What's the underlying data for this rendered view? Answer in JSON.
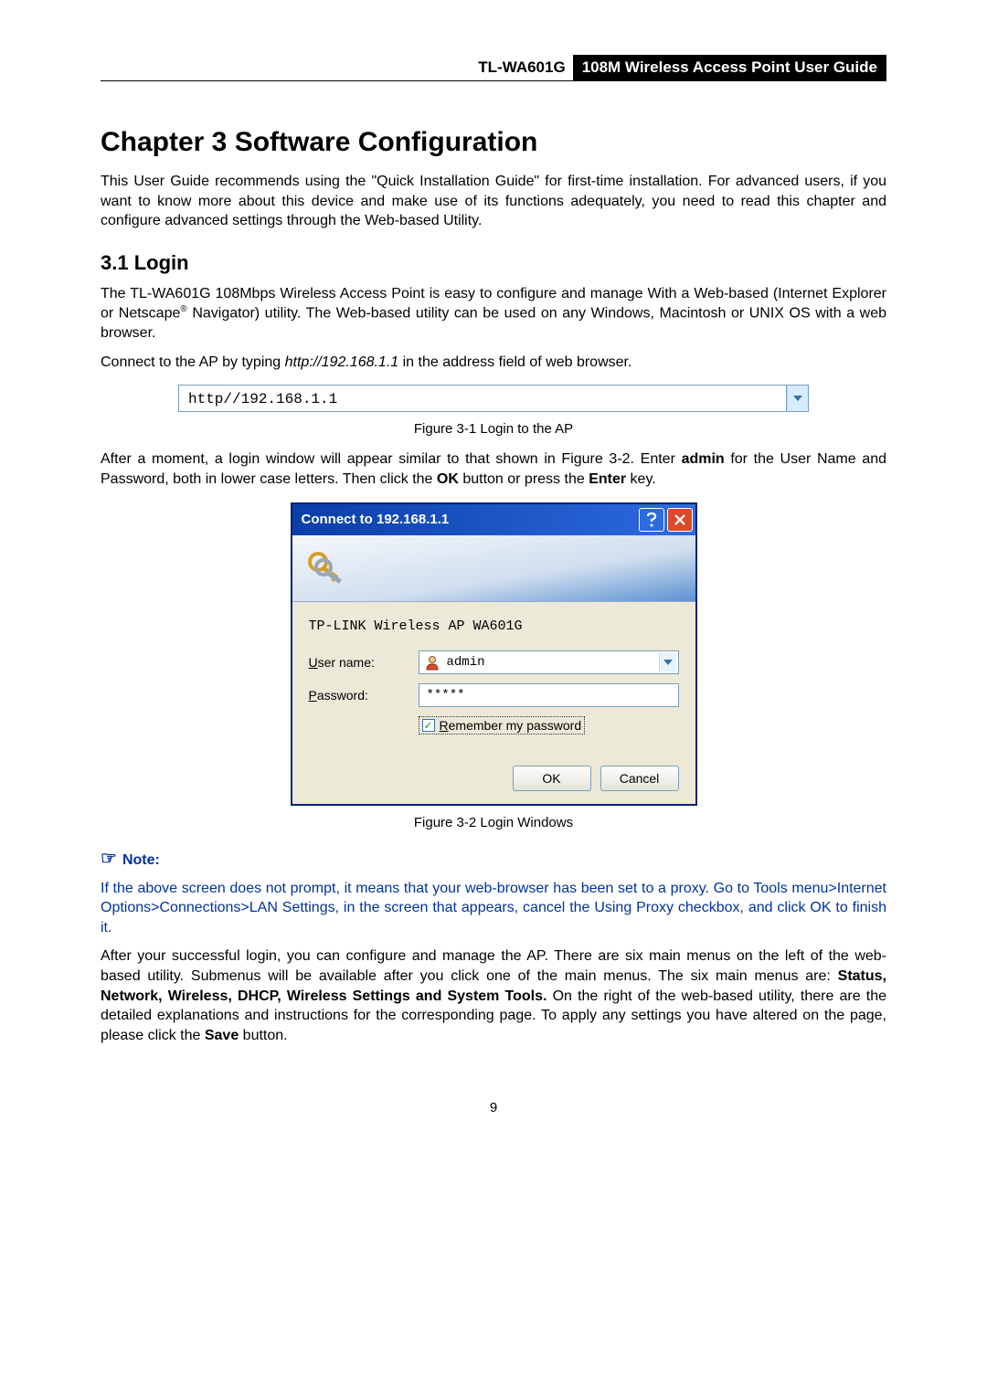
{
  "header": {
    "model": "TL-WA601G",
    "title": "108M Wireless Access Point User Guide"
  },
  "chapter": {
    "title": "Chapter 3  Software Configuration",
    "intro": "This User Guide recommends using the \"Quick Installation Guide\" for first-time installation. For advanced users, if you want to know more about this device and make use of its functions adequately, you need to read this chapter and configure advanced settings through the Web-based Utility."
  },
  "s31": {
    "heading": "3.1   Login",
    "p1_a": "The TL-WA601G 108Mbps Wireless Access Point is easy to configure and manage With a Web-based (Internet Explorer or Netscape",
    "p1_b": " Navigator) utility. The Web-based utility can be used on any Windows, Macintosh or UNIX OS with a web browser.",
    "p2_a": "Connect to the AP by typing ",
    "p2_url": "http://192.168.1.1",
    "p2_b": " in the address field of web browser."
  },
  "fig1": {
    "addr_text": "http//192.168.1.1",
    "caption": "Figure 3-1 Login to the AP"
  },
  "after_fig1": {
    "a": "After a moment, a login window will appear similar to that shown in Figure 3-2. Enter ",
    "b": "admin",
    "c": " for the User Name and Password, both in lower case letters. Then click the ",
    "d": "OK",
    "e": " button or press the ",
    "f": "Enter",
    "g": " key."
  },
  "dlg": {
    "title": "Connect to 192.168.1.1",
    "conn_name": "TP-LINK Wireless AP WA601G",
    "user_label": "User name:",
    "user_ul": "U",
    "user_rest": "ser name:",
    "user_value": "admin",
    "pass_label": "Password:",
    "pass_ul": "P",
    "pass_rest": "assword:",
    "pass_value": "*****",
    "remember_ul": "R",
    "remember_rest": "emember my password",
    "ok": "OK",
    "cancel": "Cancel"
  },
  "fig2": {
    "caption": "Figure 3-2 Login Windows"
  },
  "note": {
    "label": "Note:",
    "body": "If the above screen does not prompt, it means that your web-browser has been set to a proxy. Go to Tools menu>Internet Options>Connections>LAN Settings, in the screen that appears, cancel the Using Proxy checkbox, and click OK to finish it."
  },
  "last": {
    "a": "After your successful login, you can configure and manage the AP. There are six main menus on the left of the web-based utility. Submenus will be available after you click one of the main menus. The six main menus are: ",
    "b": "Status, Network, Wireless, DHCP, Wireless Settings and System Tools.",
    "c": " On the right of the web-based utility, there are the detailed explanations and instructions for the corresponding page. To apply any settings you have altered on the page, please click the ",
    "d": "Save",
    "e": " button."
  },
  "page_number": "9"
}
